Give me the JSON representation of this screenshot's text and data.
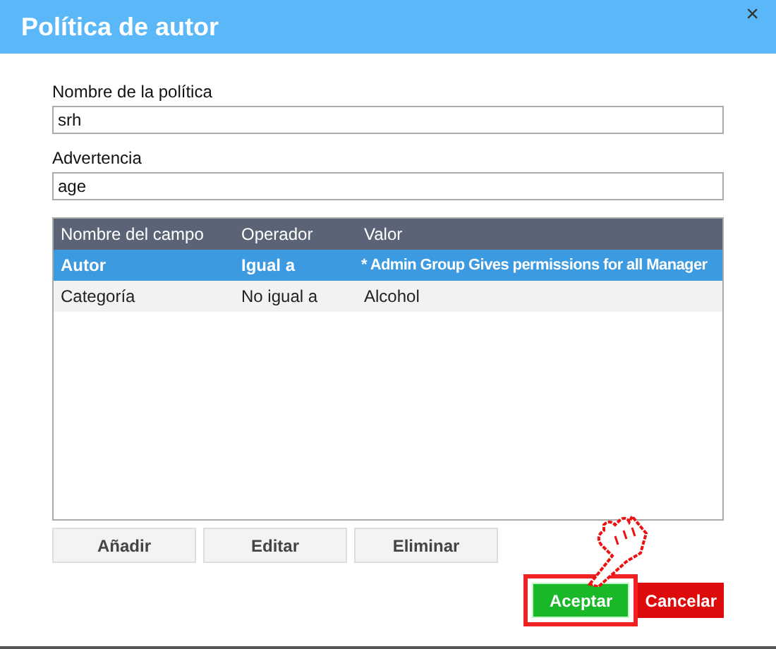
{
  "window": {
    "title": "Política de autor",
    "close": "×"
  },
  "fields": [
    {
      "label": "Nombre de la política",
      "value": "srh"
    },
    {
      "label": "Advertencia",
      "value": "age"
    }
  ],
  "table": {
    "columns": [
      "Nombre del campo",
      "Operador",
      "Valor"
    ],
    "rows": [
      {
        "cells": [
          "Autor",
          "Igual a",
          "* Admin Group Gives permissions for all Manager"
        ],
        "selected": true
      },
      {
        "cells": [
          "Categoría",
          "No igual a",
          "Alcohol"
        ],
        "selected": false
      }
    ]
  },
  "table_buttons": [
    "Añadir",
    "Editar",
    "Eliminar"
  ],
  "footer_buttons": [
    {
      "label": "Aceptar",
      "kind": "primary",
      "highlighted": true
    },
    {
      "label": "Cancelar",
      "kind": "danger",
      "highlighted": false
    }
  ]
}
